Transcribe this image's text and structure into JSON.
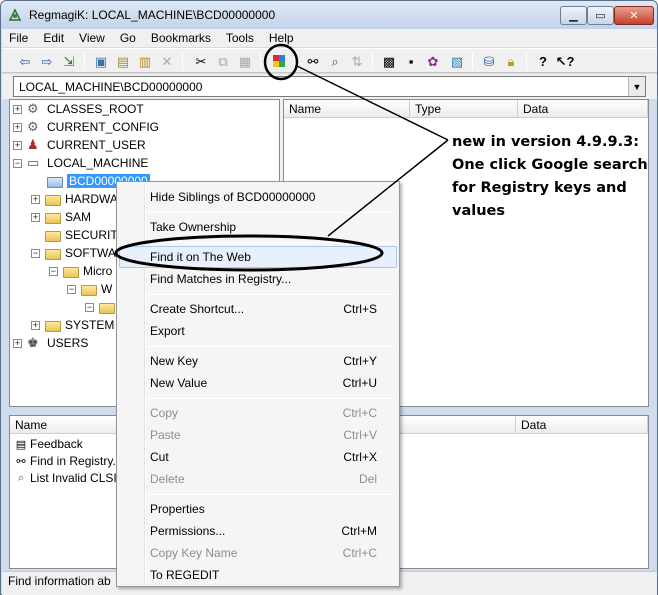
{
  "window": {
    "title": "RegmagiK: LOCAL_MACHINE\\BCD00000000",
    "minimize": "0",
    "maximize": "1",
    "close": "r"
  },
  "menubar": [
    "File",
    "Edit",
    "View",
    "Go",
    "Bookmarks",
    "Tools",
    "Help"
  ],
  "address": {
    "value": "LOCAL_MACHINE\\BCD00000000",
    "dropdown": "▼"
  },
  "tree": {
    "plus": "+",
    "minus": "−",
    "items": [
      {
        "label": "CLASSES_ROOT"
      },
      {
        "label": "CURRENT_CONFIG"
      },
      {
        "label": "CURRENT_USER"
      },
      {
        "label": "LOCAL_MACHINE"
      },
      {
        "label": "BCD00000000"
      },
      {
        "label": "HARDWA"
      },
      {
        "label": "SAM"
      },
      {
        "label": "SECURIT"
      },
      {
        "label": "SOFTWA"
      },
      {
        "label": "Micro"
      },
      {
        "label": "W"
      },
      {
        "label": ""
      },
      {
        "label": "SYSTEM"
      },
      {
        "label": "USERS"
      }
    ]
  },
  "data_pane": {
    "columns": [
      "Name",
      "Type",
      "Data"
    ]
  },
  "bottom_pane": {
    "columns": [
      "Name",
      "Data"
    ],
    "items": [
      {
        "label": "Feedback"
      },
      {
        "label": "Find in Registry..."
      },
      {
        "label": "List Invalid CLSID"
      }
    ]
  },
  "status": "Find information ab",
  "context_menu": {
    "items": [
      {
        "label": "Hide Siblings of BCD00000000",
        "shortcut": ""
      },
      {
        "label": "Take Ownership",
        "shortcut": ""
      },
      {
        "label": "Find it on The Web",
        "shortcut": ""
      },
      {
        "label": "Find Matches in Registry...",
        "shortcut": ""
      },
      {
        "label": "Create Shortcut...",
        "shortcut": "Ctrl+S"
      },
      {
        "label": "Export",
        "shortcut": ""
      },
      {
        "label": "New Key",
        "shortcut": "Ctrl+Y"
      },
      {
        "label": "New Value",
        "shortcut": "Ctrl+U"
      },
      {
        "label": "Copy",
        "shortcut": "Ctrl+C"
      },
      {
        "label": "Paste",
        "shortcut": "Ctrl+V"
      },
      {
        "label": "Cut",
        "shortcut": "Ctrl+X"
      },
      {
        "label": "Delete",
        "shortcut": "Del"
      },
      {
        "label": "Properties",
        "shortcut": ""
      },
      {
        "label": "Permissions...",
        "shortcut": "Ctrl+M"
      },
      {
        "label": "Copy Key Name",
        "shortcut": "Ctrl+C"
      },
      {
        "label": "To REGEDIT",
        "shortcut": ""
      }
    ]
  },
  "annotation": {
    "lines": [
      "new in version 4.9.9.3:",
      "One click Google search",
      "for Registry keys  and",
      "values"
    ]
  },
  "toolbar_icons": {
    "back": "back-arrow-icon",
    "forward": "forward-arrow-icon",
    "go": "go-icon",
    "web_search": "google-search-icon"
  },
  "colors": {
    "selection": "#3399ff",
    "menu_highlight": "#e8f1fb",
    "window_frame": "#cfdcec"
  }
}
